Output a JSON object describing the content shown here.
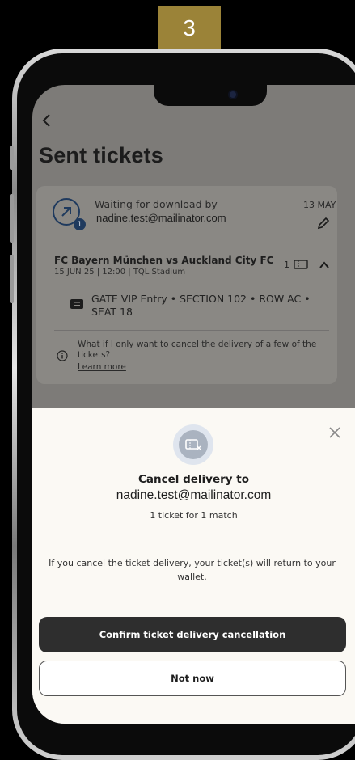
{
  "step": {
    "number": "3",
    "color": "#9b8338"
  },
  "page": {
    "title": "Sent tickets"
  },
  "transfer": {
    "status_label": "Waiting for download by",
    "recipient_email": "nadine.test@mailinator.com",
    "date": "13 MAY",
    "badge_count": "1",
    "match": {
      "title": "FC Bayern München vs Auckland City FC",
      "details": "15 JUN 25 | 12:00 | TQL Stadium",
      "ticket_count": "1"
    },
    "seat": {
      "line1": "GATE VIP Entry • SECTION 102 • ROW AC •",
      "line2": "SEAT 18"
    },
    "faq": {
      "question": "What if I only want to cancel the delivery of a few of the tickets?",
      "link_label": "Learn more"
    }
  },
  "dialog": {
    "title": "Cancel delivery to",
    "email": "nadine.test@mailinator.com",
    "subtitle": "1 ticket for 1 match",
    "note": "If you cancel the ticket delivery, your ticket(s) will return to your wallet.",
    "confirm_label": "Confirm ticket delivery cancellation",
    "dismiss_label": "Not now"
  },
  "icons": [
    "chevron-left-icon",
    "arrow-up-right-icon",
    "edit-icon",
    "ticket-icon",
    "chevron-up-icon",
    "info-icon",
    "close-icon",
    "cancel-ticket-icon"
  ]
}
